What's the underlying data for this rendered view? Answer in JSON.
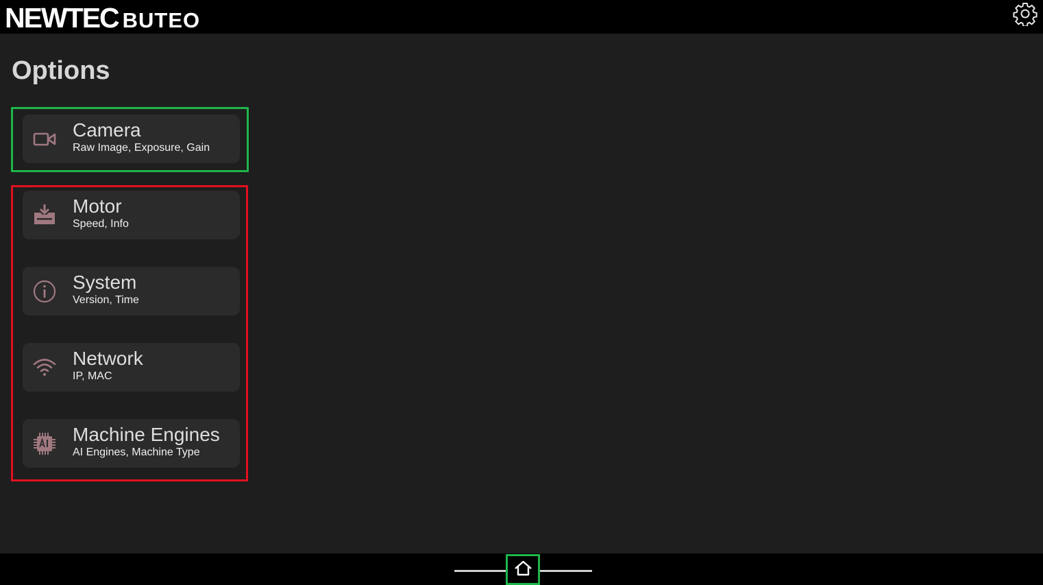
{
  "header": {
    "brand": "NEWTEC",
    "product": "BUTEO",
    "settings_icon": "gear-icon"
  },
  "page": {
    "title": "Options"
  },
  "items": [
    {
      "label": "Camera",
      "subtitle": "Raw Image, Exposure, Gain",
      "icon": "camera-icon"
    },
    {
      "label": "Motor",
      "subtitle": "Speed, Info",
      "icon": "motor-icon"
    },
    {
      "label": "System",
      "subtitle": "Version, Time",
      "icon": "info-icon"
    },
    {
      "label": "Network",
      "subtitle": "IP, MAC",
      "icon": "wifi-icon"
    },
    {
      "label": "Machine Engines",
      "subtitle": "AI Engines, Machine Type",
      "icon": "ai-chip-icon"
    }
  ],
  "navigation": {
    "home_icon": "home-icon"
  },
  "colors": {
    "background": "#1e1e1f",
    "bar": "#000000",
    "card": "#2b2b2b",
    "icon": "#a07880",
    "highlight_green": "#1fb54a",
    "highlight_red": "#e3101e"
  }
}
